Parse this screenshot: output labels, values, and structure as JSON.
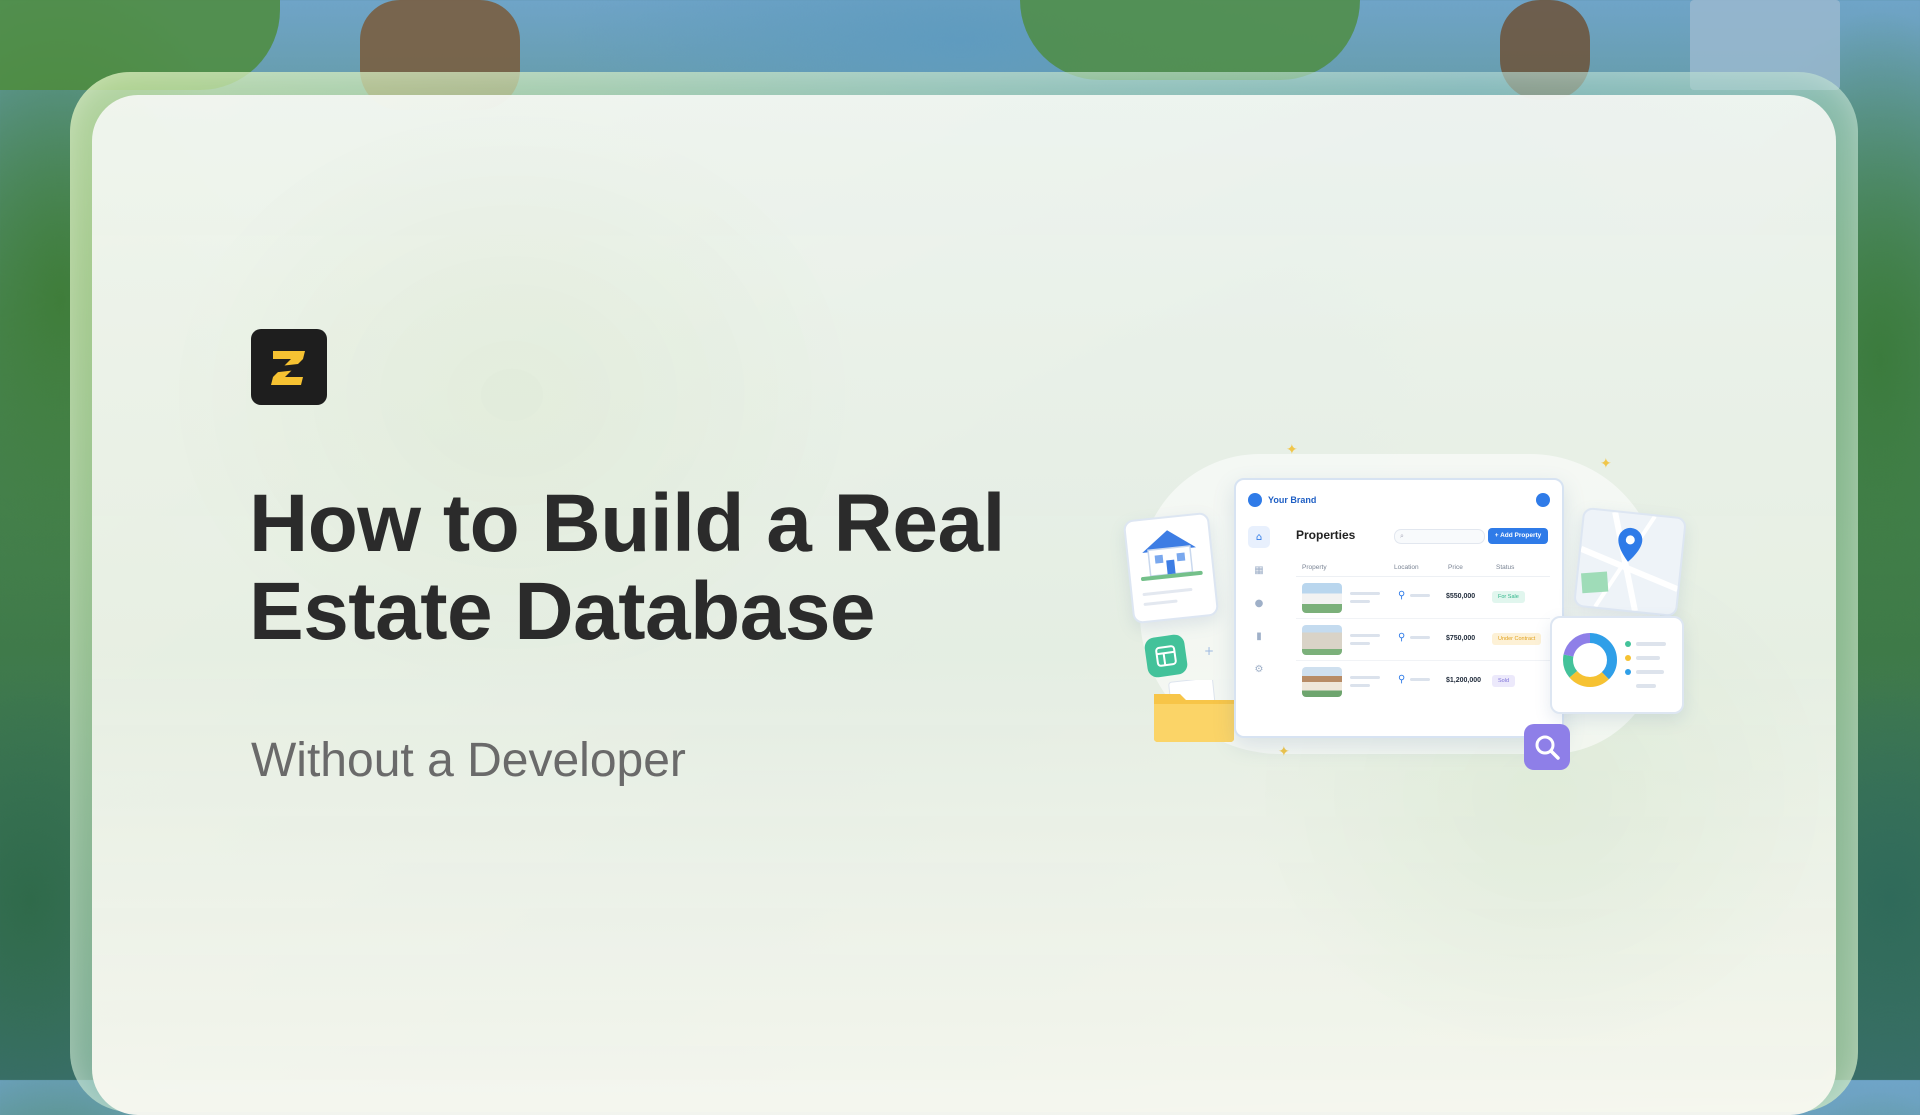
{
  "title_lines": [
    "How to Build a Real",
    "Estate Database"
  ],
  "subtitle": "Without a Developer",
  "logo": {
    "icon": "zoho-z-logo-icon",
    "colors": {
      "background": "#1e1e1e",
      "mark": "#f6c232"
    }
  },
  "illustration": {
    "brand": "Your Brand",
    "heading": "Properties",
    "add_button": "+ Add Property",
    "columns": [
      "Property",
      "Location",
      "Price",
      "Status"
    ],
    "rows": [
      {
        "price": "$550,000",
        "status": "For Sale",
        "status_color": "#2fb58a",
        "status_bg": "#e1f6ee"
      },
      {
        "price": "$750,000",
        "status": "Under Contract",
        "status_color": "#e2a21f",
        "status_bg": "#fdf1d6"
      },
      {
        "price": "$1,200,000",
        "status": "Sold",
        "status_color": "#7c6fd8",
        "status_bg": "#ece9fb"
      }
    ],
    "accent_color": "#2f7be8"
  }
}
